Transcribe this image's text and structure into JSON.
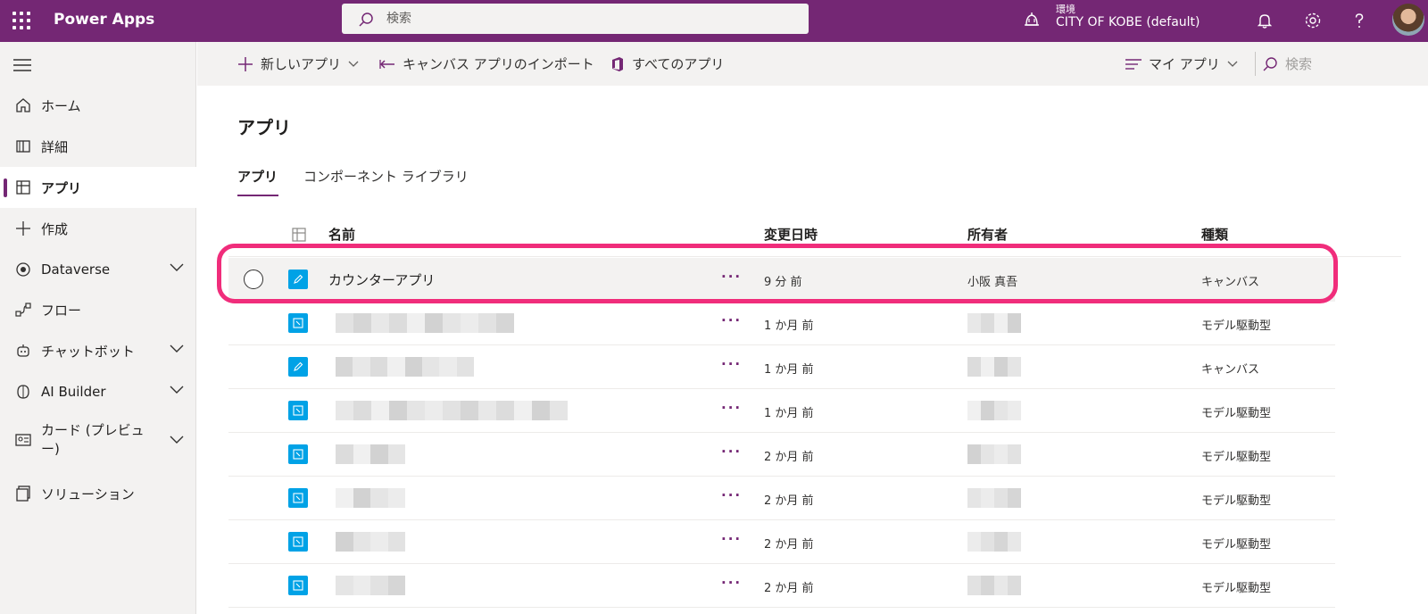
{
  "app": {
    "brand": "Power Apps"
  },
  "top_search": {
    "placeholder": "検索"
  },
  "environment": {
    "label": "環境",
    "name": "CITY OF KOBE (default)"
  },
  "sidebar": {
    "items": [
      {
        "label": "ホーム",
        "icon": "home-icon"
      },
      {
        "label": "詳細",
        "icon": "book-icon"
      },
      {
        "label": "アプリ",
        "icon": "apps-icon",
        "active": true
      },
      {
        "label": "作成",
        "icon": "plus-icon"
      },
      {
        "label": "Dataverse",
        "icon": "dataverse-icon",
        "expandable": true
      },
      {
        "label": "フロー",
        "icon": "flow-icon"
      },
      {
        "label": "チャットボット",
        "icon": "bot-icon",
        "expandable": true
      },
      {
        "label": "AI Builder",
        "icon": "ai-builder-icon",
        "expandable": true
      },
      {
        "label": "カード (プレビュー)",
        "icon": "card-icon",
        "expandable": true
      },
      {
        "label": "ソリューション",
        "icon": "solution-icon"
      }
    ]
  },
  "command_bar": {
    "new_app": "新しいアプリ",
    "import_canvas": "キャンバス アプリのインポート",
    "all_apps": "すべてのアプリ",
    "filter": "マイ アプリ",
    "search_placeholder": "検索"
  },
  "page": {
    "title": "アプリ",
    "tabs": [
      {
        "label": "アプリ",
        "active": true
      },
      {
        "label": "コンポーネント ライブラリ"
      }
    ]
  },
  "table": {
    "headers": {
      "name": "名前",
      "modified": "変更日時",
      "owner": "所有者",
      "type": "種類"
    },
    "more_label": "···",
    "rows": [
      {
        "name": "カウンターアプリ",
        "modified": "9 分 前",
        "owner": "小阪 真吾",
        "type": "キャンバス",
        "app_kind": "canvas",
        "selected": true
      },
      {
        "name": "",
        "modified": "1 か月 前",
        "owner": "",
        "type": "モデル駆動型",
        "app_kind": "model"
      },
      {
        "name": "",
        "modified": "1 か月 前",
        "owner": "",
        "type": "キャンバス",
        "app_kind": "canvas"
      },
      {
        "name": "",
        "modified": "1 か月 前",
        "owner": "",
        "type": "モデル駆動型",
        "app_kind": "model"
      },
      {
        "name": "",
        "modified": "2 か月 前",
        "owner": "",
        "type": "モデル駆動型",
        "app_kind": "model"
      },
      {
        "name": "",
        "modified": "2 か月 前",
        "owner": "",
        "type": "モデル駆動型",
        "app_kind": "model"
      },
      {
        "name": "",
        "modified": "2 か月 前",
        "owner": "",
        "type": "モデル駆動型",
        "app_kind": "model"
      },
      {
        "name": "",
        "modified": "2 か月 前",
        "owner": "",
        "type": "モデル駆動型",
        "app_kind": "model"
      }
    ]
  },
  "colors": {
    "brand": "#742774",
    "highlight": "#f02d7b",
    "app_icon": "#00a2e6"
  }
}
